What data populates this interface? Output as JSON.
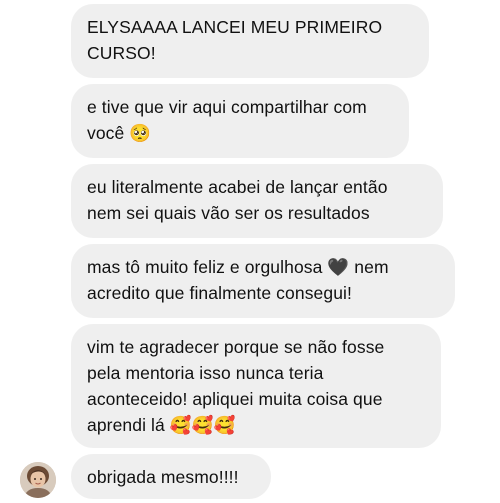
{
  "messages": [
    {
      "text": "ELYSAAAA LANCEI MEU PRIMEIRO\nCURSO!"
    },
    {
      "text": "e tive que vir aqui compartilhar com\nvocê 🥺"
    },
    {
      "text": "eu literalmente acabei de lançar então\nnem sei quais vão ser os resultados"
    },
    {
      "text": "mas tô muito feliz e orgulhosa 🖤 nem\nacredito que finalmente consegui!"
    },
    {
      "text": "vim te agradecer porque se não fosse\npela mentoria isso nunca teria\naconteceido! apliquei muita coisa que\naprendi lá 🥰🥰🥰"
    },
    {
      "text": "obrigada mesmo!!!!"
    }
  ],
  "sender_avatar": {
    "icon": "user-avatar-photo"
  },
  "colors": {
    "bubble_background": "#efefef",
    "text": "#111111"
  }
}
